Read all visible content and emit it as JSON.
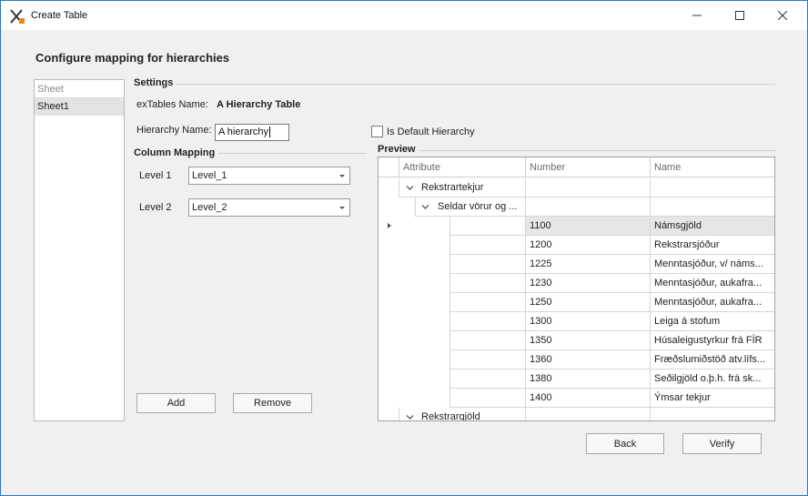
{
  "window": {
    "title": "Create Table"
  },
  "heading": "Configure mapping for hierarchies",
  "sheets": {
    "header": "Sheet",
    "items": [
      "Sheet1"
    ]
  },
  "settings": {
    "title": "Settings",
    "extables_label": "exTables Name:",
    "extables_value": "A Hierarchy Table",
    "hierarchy_label": "Hierarchy Name:",
    "hierarchy_value": "A hierarchy",
    "default_label": "Is Default Hierarchy",
    "default_checked": false
  },
  "column_mapping": {
    "title": "Column Mapping",
    "levels": [
      {
        "label": "Level 1",
        "value": "Level_1"
      },
      {
        "label": "Level 2",
        "value": "Level_2"
      }
    ],
    "add_label": "Add",
    "remove_label": "Remove"
  },
  "preview": {
    "title": "Preview",
    "columns": [
      "Attribute",
      "Number",
      "Name"
    ],
    "group1": "Rekstrartekjur",
    "subgroup1": "Seldar vörur og ...",
    "rows": [
      {
        "number": "1100",
        "name": "Námsgjöld"
      },
      {
        "number": "1200",
        "name": "Rekstrarsjóður"
      },
      {
        "number": "1225",
        "name": "Menntasjóður,  v/ náms..."
      },
      {
        "number": "1230",
        "name": "Menntasjóður, aukafra..."
      },
      {
        "number": "1250",
        "name": "Menntasjóður, aukafra..."
      },
      {
        "number": "1300",
        "name": "Leiga á stofum"
      },
      {
        "number": "1350",
        "name": "Húsaleigustyrkur frá FÍR"
      },
      {
        "number": "1360",
        "name": "Fræðslumiðstöð atv.lífs..."
      },
      {
        "number": "1380",
        "name": "Seðilgjöld o.þ.h. frá sk..."
      },
      {
        "number": "1400",
        "name": "Ýmsar tekjur"
      }
    ],
    "group2": "Rekstrargjöld"
  },
  "footer": {
    "back_label": "Back",
    "verify_label": "Verify"
  },
  "colors": {
    "window_border": "#2b77c9",
    "background": "#f0f0f0",
    "selected_row": "#e6e6e6"
  }
}
